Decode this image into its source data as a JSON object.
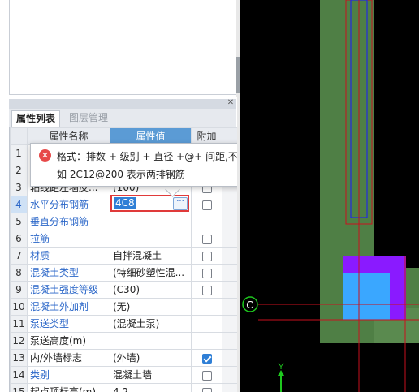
{
  "tabs": {
    "properties": "属性列表",
    "layers": "图层管理"
  },
  "close_symbol": "✕",
  "columns": {
    "name": "属性名称",
    "value": "属性值",
    "extra": "附加"
  },
  "rows": [
    {
      "num": "1",
      "name": "",
      "value": "",
      "checkbox": false,
      "blue": false
    },
    {
      "num": "2",
      "name": "",
      "value": "",
      "checkbox": false,
      "blue": false
    },
    {
      "num": "3",
      "name": "轴线距左墙皮...",
      "value": "(100)",
      "checkbox": false,
      "blue": false
    },
    {
      "num": "4",
      "name": "水平分布钢筋",
      "value": "4C8",
      "checkbox": false,
      "blue": true
    },
    {
      "num": "5",
      "name": "垂直分布钢筋",
      "value": "",
      "checkbox": null,
      "blue": true
    },
    {
      "num": "6",
      "name": "拉筋",
      "value": "",
      "checkbox": false,
      "blue": true
    },
    {
      "num": "7",
      "name": "材质",
      "value": "自拌混凝土",
      "checkbox": false,
      "blue": true
    },
    {
      "num": "8",
      "name": "混凝土类型",
      "value": "(特细砂塑性混...",
      "checkbox": false,
      "blue": true
    },
    {
      "num": "9",
      "name": "混凝土强度等级",
      "value": "(C30)",
      "checkbox": false,
      "blue": true
    },
    {
      "num": "10",
      "name": "混凝土外加剂",
      "value": "(无)",
      "checkbox": null,
      "blue": true
    },
    {
      "num": "11",
      "name": "泵送类型",
      "value": "(混凝土泵)",
      "checkbox": null,
      "blue": true
    },
    {
      "num": "12",
      "name": "泵送高度(m)",
      "value": "",
      "checkbox": null,
      "blue": false
    },
    {
      "num": "13",
      "name": "内/外墙标志",
      "value": "(外墙)",
      "checkbox": true,
      "blue": false
    },
    {
      "num": "14",
      "name": "类别",
      "value": "混凝土墙",
      "checkbox": false,
      "blue": true
    },
    {
      "num": "15",
      "name": "起点顶标高(m)",
      "value": "4.2",
      "checkbox": false,
      "blue": false
    }
  ],
  "editing": {
    "value": "4C8",
    "more_button": "···"
  },
  "tooltip": {
    "icon": "✕",
    "line1": "格式：排数 + 级别 + 直径 +@+ 间距,不同直径用加号连接,例",
    "line2": "如 2C12@200 表示两排钢筋"
  },
  "canvas": {
    "axis_label": "C",
    "y_axis_label": "Y"
  },
  "colors": {
    "wall_green": "#4f7f45",
    "column_purple": "#8a1aff",
    "column_blue": "#3aa7ff",
    "axis_red": "#c8101e",
    "axis_green": "#1ec81e",
    "header_blue": "#5b9bd5",
    "tooltip_error_red": "#e74848"
  }
}
